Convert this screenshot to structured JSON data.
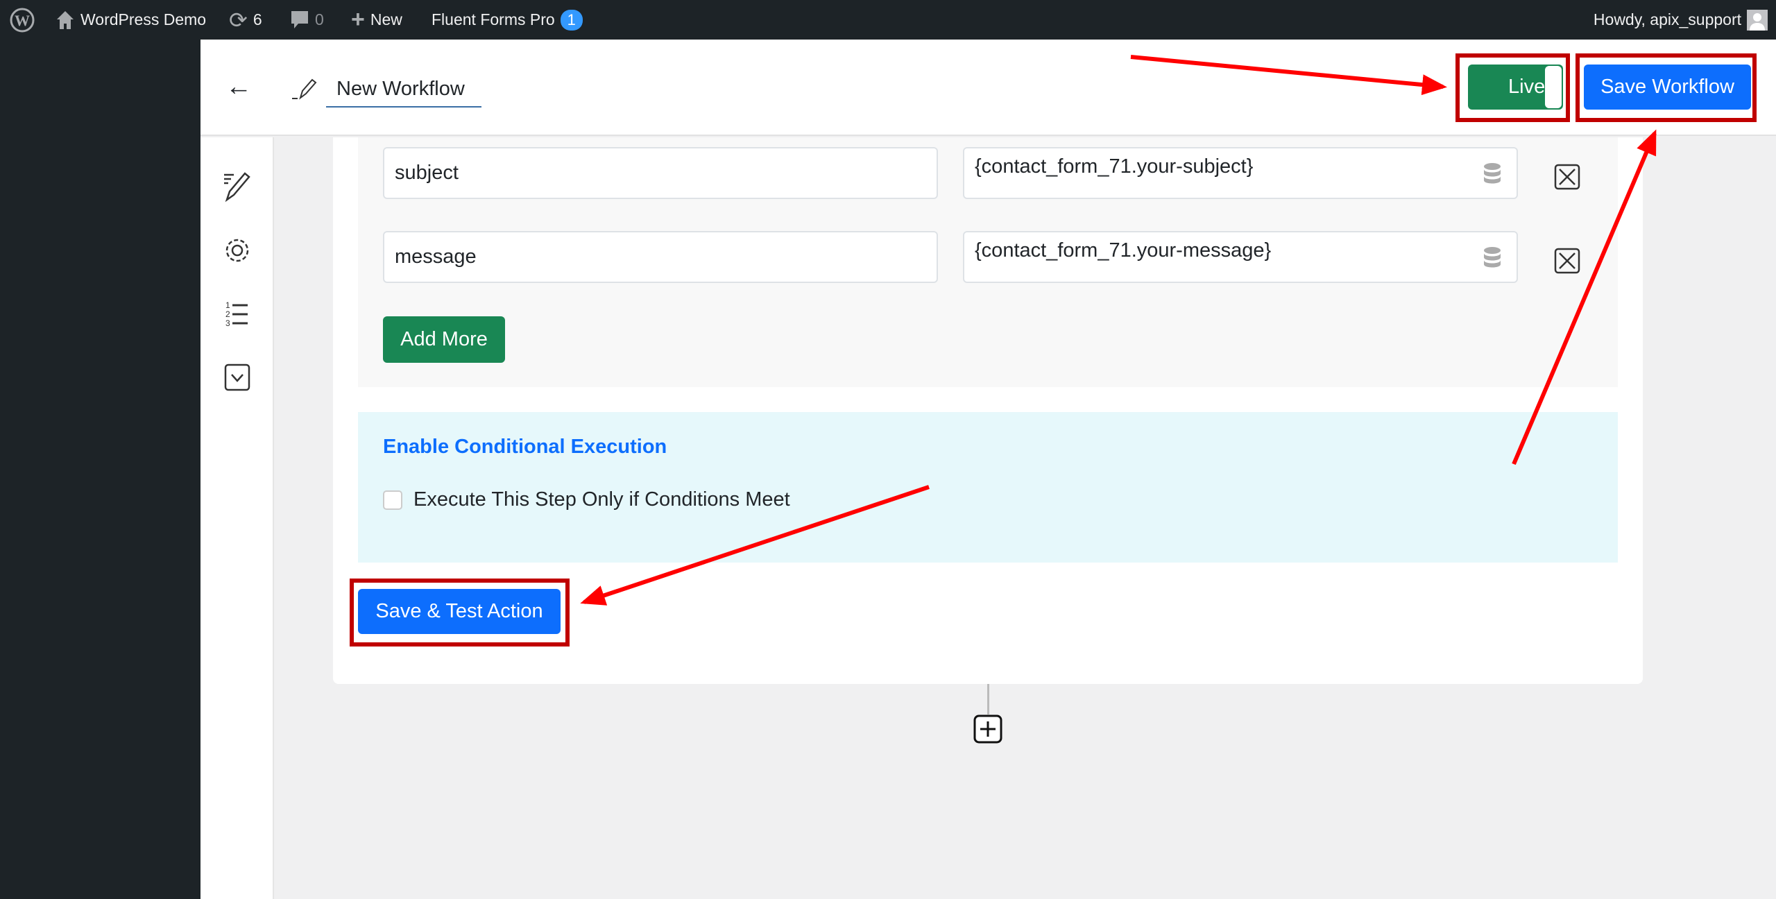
{
  "admin_bar": {
    "site_name": "WordPress Demo",
    "updates_count": "6",
    "comments_count": "0",
    "new_label": "New",
    "plugin_label": "Fluent Forms Pro",
    "plugin_badge": "1",
    "greeting": "Howdy, apix_support"
  },
  "header": {
    "workflow_title": "New Workflow",
    "live_label": "Live",
    "save_workflow_label": "Save Workflow"
  },
  "sidebar_icons": [
    "edit-list-icon",
    "gear-icon",
    "numbered-list-icon",
    "chevron-down-box-icon"
  ],
  "fields": [
    {
      "key": "subject",
      "value": "{contact_form_71.your-subject}"
    },
    {
      "key": "message",
      "value": "{contact_form_71.your-message}"
    }
  ],
  "add_more_label": "Add More",
  "conditional": {
    "title": "Enable Conditional Execution",
    "checkbox_label": "Execute This Step Only if Conditions Meet",
    "checked": false
  },
  "save_test_label": "Save & Test Action",
  "colors": {
    "primary": "#0d6efd",
    "success": "#198754",
    "annotation": "#c00000",
    "arrow": "#ff0000",
    "cond_bg": "#e6f8fb",
    "cond_title": "#0d6efd"
  }
}
